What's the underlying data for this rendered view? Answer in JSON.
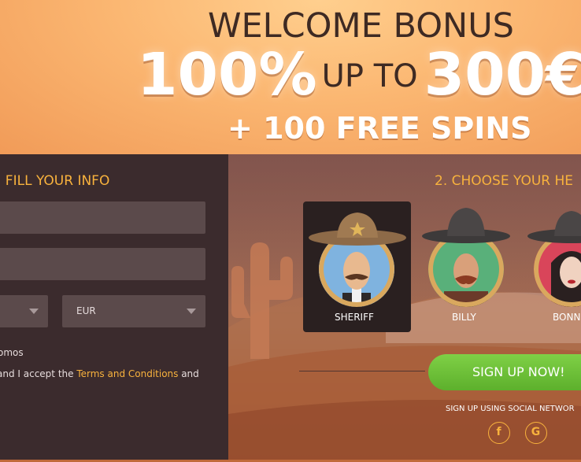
{
  "banner": {
    "welcome": "WELCOME BONUS",
    "percent": "100%",
    "up_to": "UP TO",
    "amount": "300€",
    "spins": "+ 100 FREE SPINS"
  },
  "form": {
    "step_title": ". FILL YOUR INFO",
    "currency_value": "EUR",
    "promos_text": "omos",
    "terms_prefix": "and I accept the ",
    "terms_link": "Terms and Conditions",
    "terms_suffix": " and"
  },
  "heroes": {
    "step_number": "2.",
    "step_title": " CHOOSE YOUR HE",
    "items": [
      {
        "name": "SHERIFF"
      },
      {
        "name": "BILLY"
      },
      {
        "name": "BONN"
      }
    ]
  },
  "cta": {
    "signup_label": "SIGN UP NOW!",
    "social_label": "SIGN UP USING SOCIAL NETWOR",
    "facebook_glyph": "f",
    "google_glyph": "G"
  },
  "colors": {
    "accent": "#f8b23d",
    "cta": "#6cc135",
    "panel": "#3b2b2d"
  }
}
